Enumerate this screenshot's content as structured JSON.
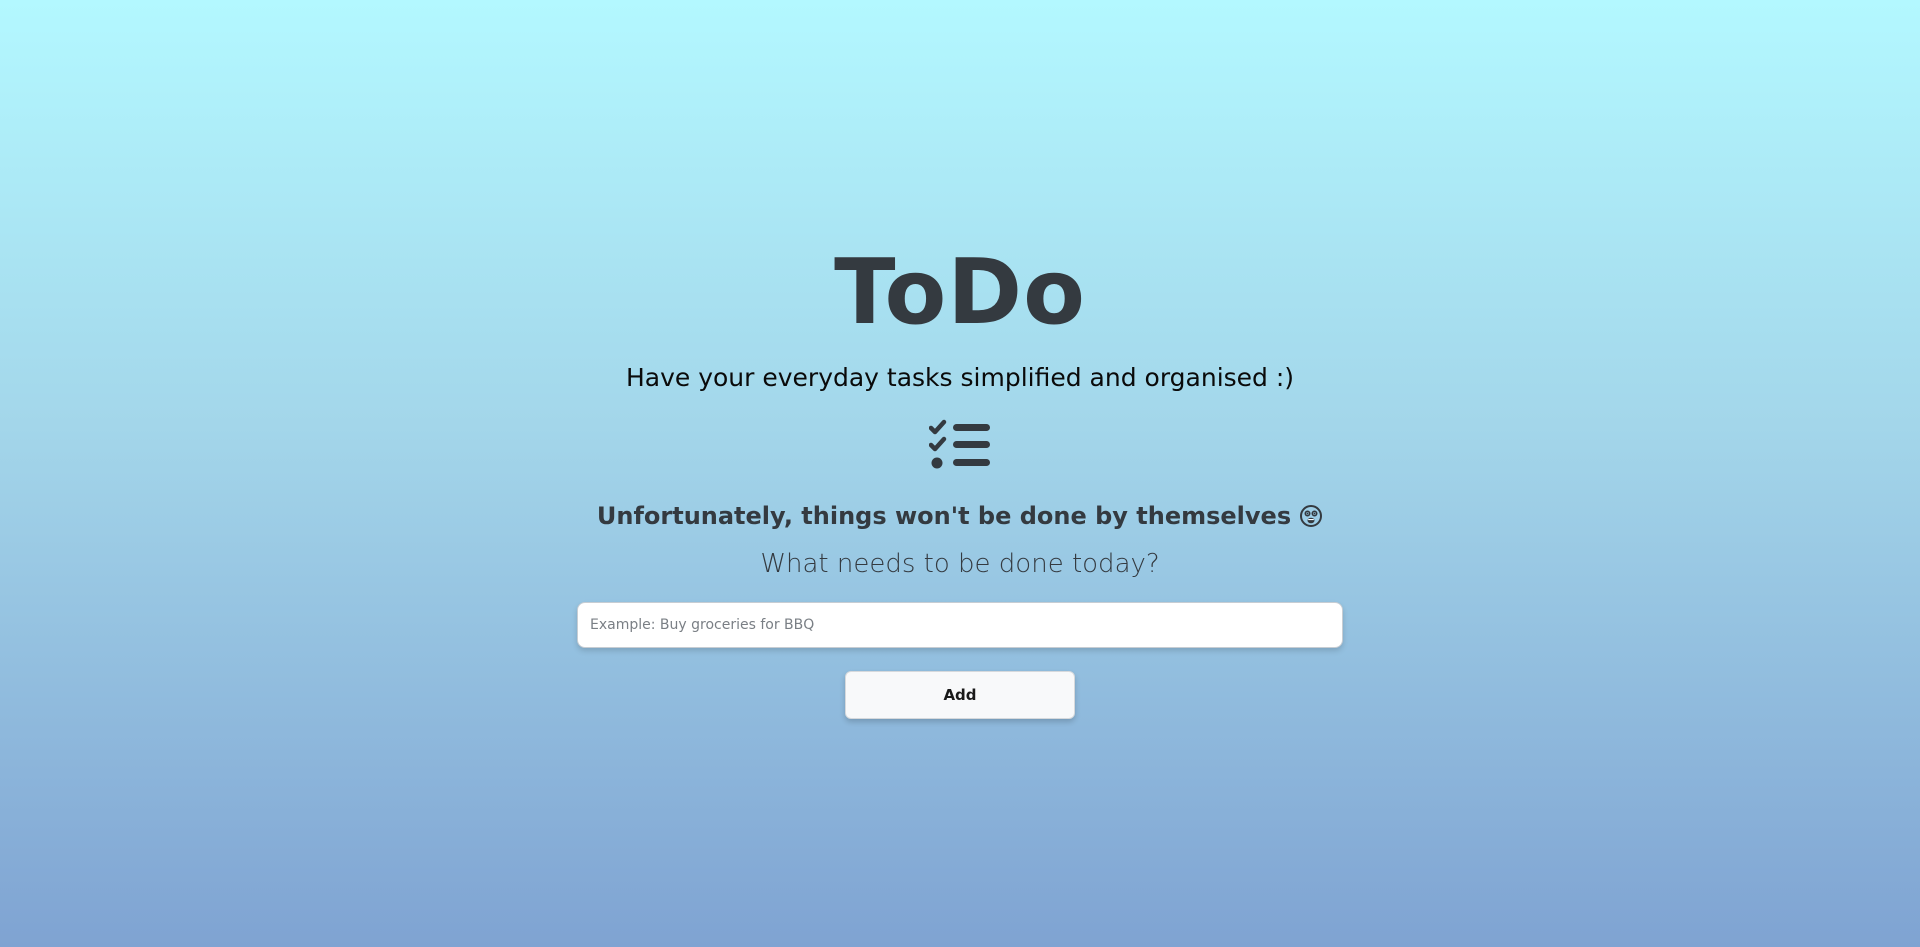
{
  "app": {
    "title": "ToDo",
    "subtitle": "Have your everyday tasks simplified and organised :)",
    "list_icon": "tasks-list-icon",
    "motivation": "Unfortunately, things won't be done by themselves",
    "motivation_emoji": "astonished-face-icon",
    "question": "What needs to be done today?"
  },
  "form": {
    "input_value": "",
    "input_placeholder": "Example: Buy groceries for BBQ",
    "add_label": "Add"
  },
  "colors": {
    "background_top": "#b3f8ff",
    "background_bottom": "#7fa3d2",
    "text_dark": "#343a40",
    "button_bg": "#f8f9fa"
  }
}
